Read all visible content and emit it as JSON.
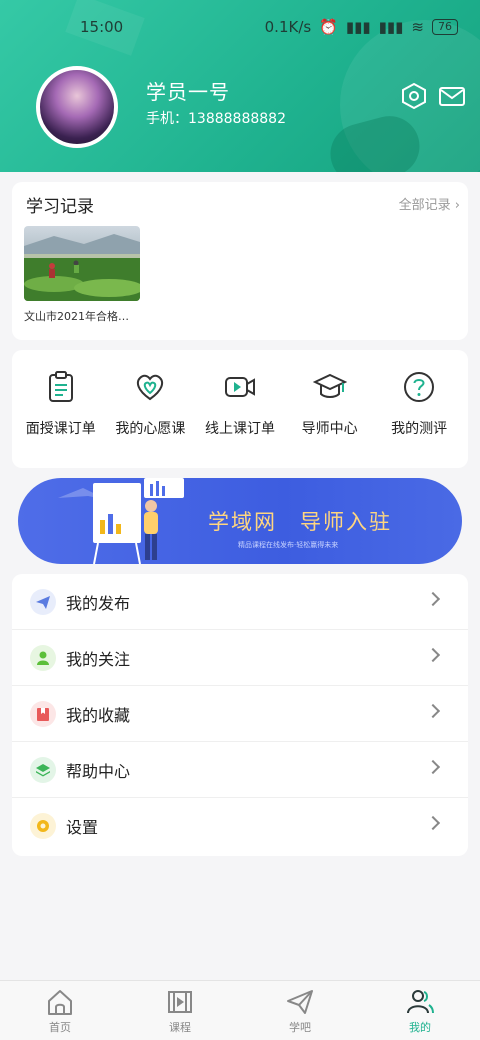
{
  "status_bar": {
    "time": "15:00",
    "network_speed": "0.1K/s",
    "battery": "76"
  },
  "profile": {
    "name": "学员一号",
    "phone": "手机：13888888882"
  },
  "study_record": {
    "title": "学习记录",
    "view_all": "全部记录",
    "items": [
      {
        "caption": "文山市2021年合格…"
      }
    ]
  },
  "shortcuts": [
    {
      "label": "面授课订单",
      "icon": "clipboard-icon"
    },
    {
      "label": "我的心愿课",
      "icon": "heart-icon"
    },
    {
      "label": "线上课订单",
      "icon": "video-icon"
    },
    {
      "label": "导师中心",
      "icon": "graduation-cap-icon"
    },
    {
      "label": "我的测评",
      "icon": "question-icon"
    }
  ],
  "banner": {
    "title": "学域网　导师入驻",
    "subtitle": "精品课程在线发布·轻松赢得未来"
  },
  "menu": [
    {
      "label": "我的发布",
      "icon": "send-icon",
      "color": "#5a7be0"
    },
    {
      "label": "我的关注",
      "icon": "user-icon",
      "color": "#5cbf3a"
    },
    {
      "label": "我的收藏",
      "icon": "bookmark-icon",
      "color": "#e85a5a"
    },
    {
      "label": "帮助中心",
      "icon": "layers-icon",
      "color": "#3cb558"
    },
    {
      "label": "设置",
      "icon": "settings-icon",
      "color": "#f2b71a"
    }
  ],
  "tabbar": [
    {
      "label": "首页",
      "icon": "home-icon"
    },
    {
      "label": "课程",
      "icon": "play-icon"
    },
    {
      "label": "学吧",
      "icon": "paper-plane-icon"
    },
    {
      "label": "我的",
      "icon": "people-icon",
      "active": true
    }
  ],
  "accent_color": "#1fb28f"
}
